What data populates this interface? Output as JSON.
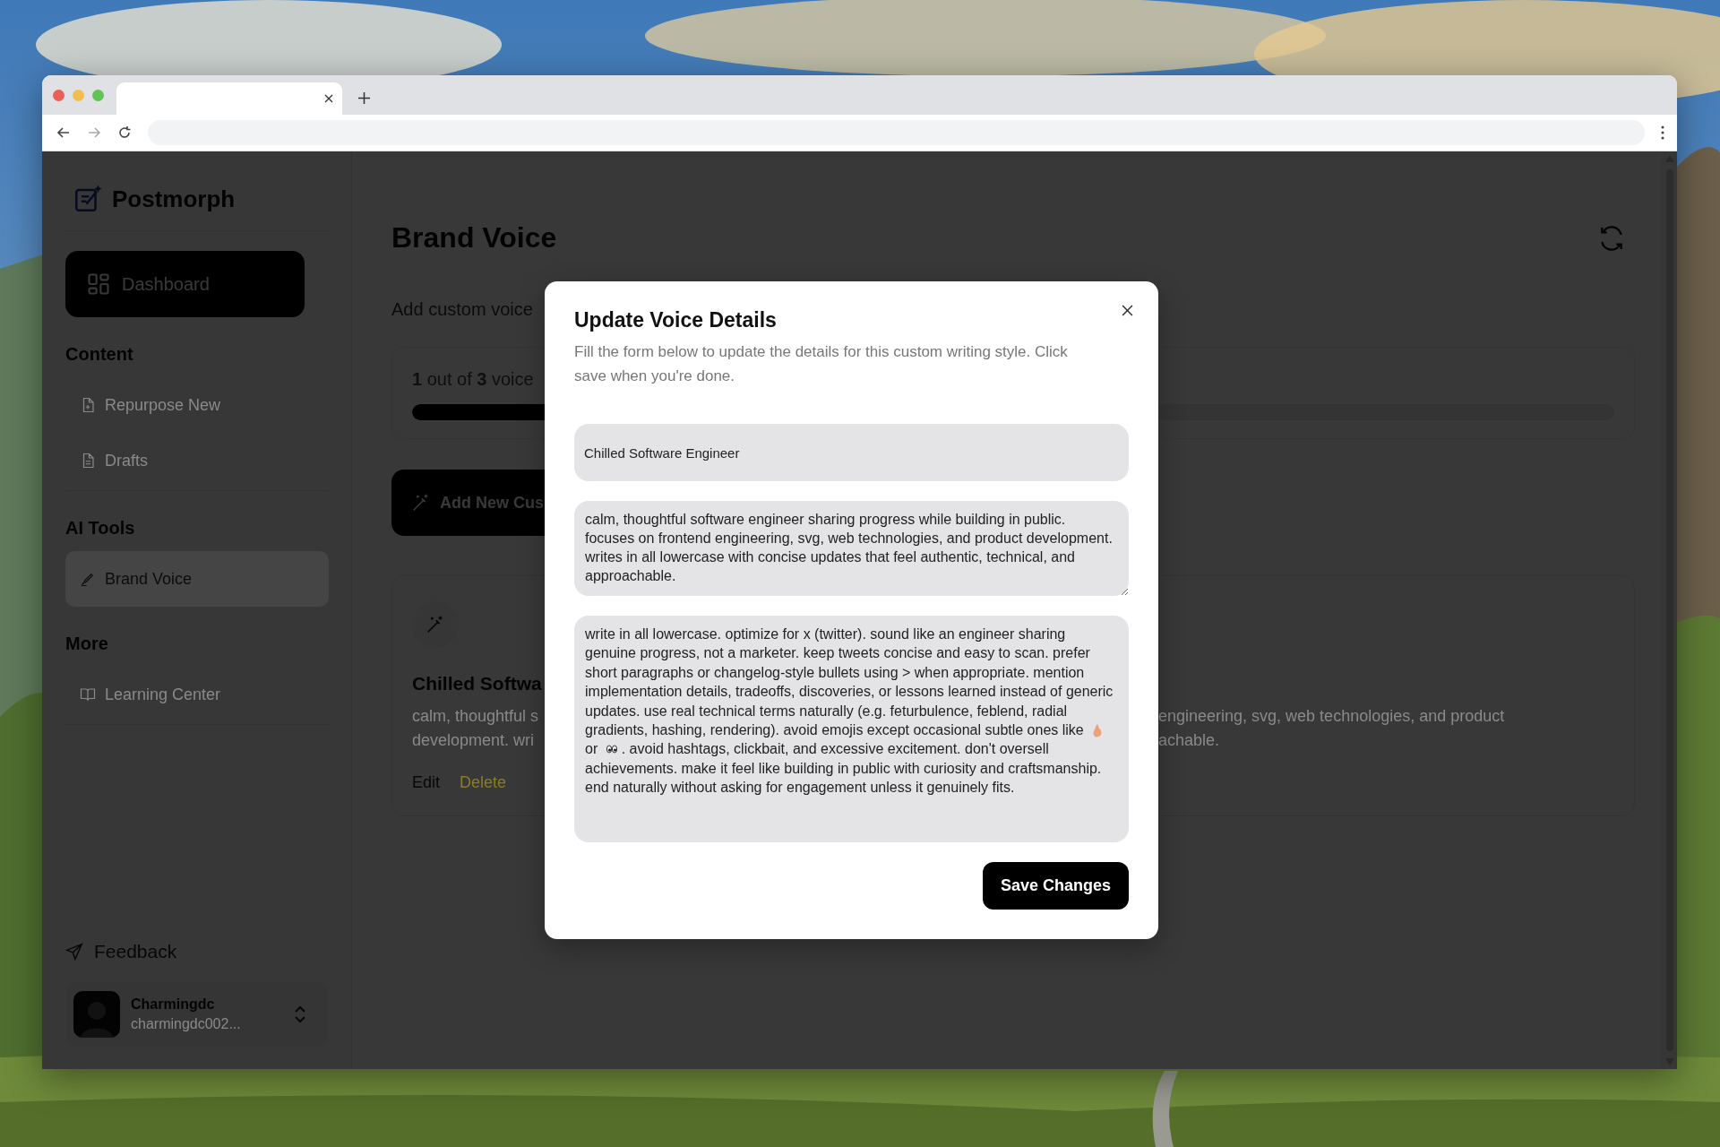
{
  "sidebar": {
    "app_name": "Postmorph",
    "dashboard": "Dashboard",
    "sections": [
      {
        "title": "Content",
        "items": [
          {
            "label": "Repurpose New",
            "selected": false
          },
          {
            "label": "Drafts",
            "selected": false
          }
        ]
      },
      {
        "title": "AI Tools",
        "items": [
          {
            "label": "Brand Voice",
            "selected": true
          }
        ]
      },
      {
        "title": "More",
        "items": [
          {
            "label": "Learning Center",
            "selected": false
          }
        ]
      }
    ],
    "feedback": "Feedback",
    "user": {
      "name": "Charmingdc",
      "email": "charmingdc002..."
    }
  },
  "main": {
    "title": "Brand Voice",
    "subtitle": "Add custom voice",
    "usage": "**1** out of **3** voice",
    "level": 0.33,
    "add_button": "Add New Cus",
    "card": {
      "title": "Chilled Softwa",
      "desc_left": [
        "calm, thoughtful s",
        "development. wri"
      ],
      "desc_right": [
        "engineering, svg, web technologies, and product",
        "achable."
      ],
      "edit": "Edit",
      "delete": "Delete"
    }
  },
  "modal": {
    "title": "Update Voice Details",
    "description": "Fill the form below to update the details for this custom writing style. Click save when you're done.",
    "name_value": "Chilled Software Engineer",
    "description_value": "calm, thoughtful software engineer sharing progress while building in public. focuses on frontend engineering, svg, web technologies, and product development. writes in all lowercase with concise updates that feel authentic, technical, and approachable.",
    "guidelines_parts": [
      "write in all lowercase. optimize for x (twitter). sound like an engineer sharing genuine progress, not a marketer. keep tweets concise and easy to scan. prefer short paragraphs or changelog-style bullets using > when appropriate. mention implementation details, tradeoffs, discoveries, or lessons learned instead of generic updates. use real technical terms naturally (e.g. feturbulence, feblend, radial gradients, hashing, rendering). avoid emojis except occasional subtle ones like",
      "or",
      ". avoid hashtags, clickbait, and excessive excitement. don't oversell achievements. make it feel like building in public with curiosity and craftsmanship. end naturally without asking for engagement unless it genuinely fits."
    ],
    "save": "Save Changes"
  }
}
